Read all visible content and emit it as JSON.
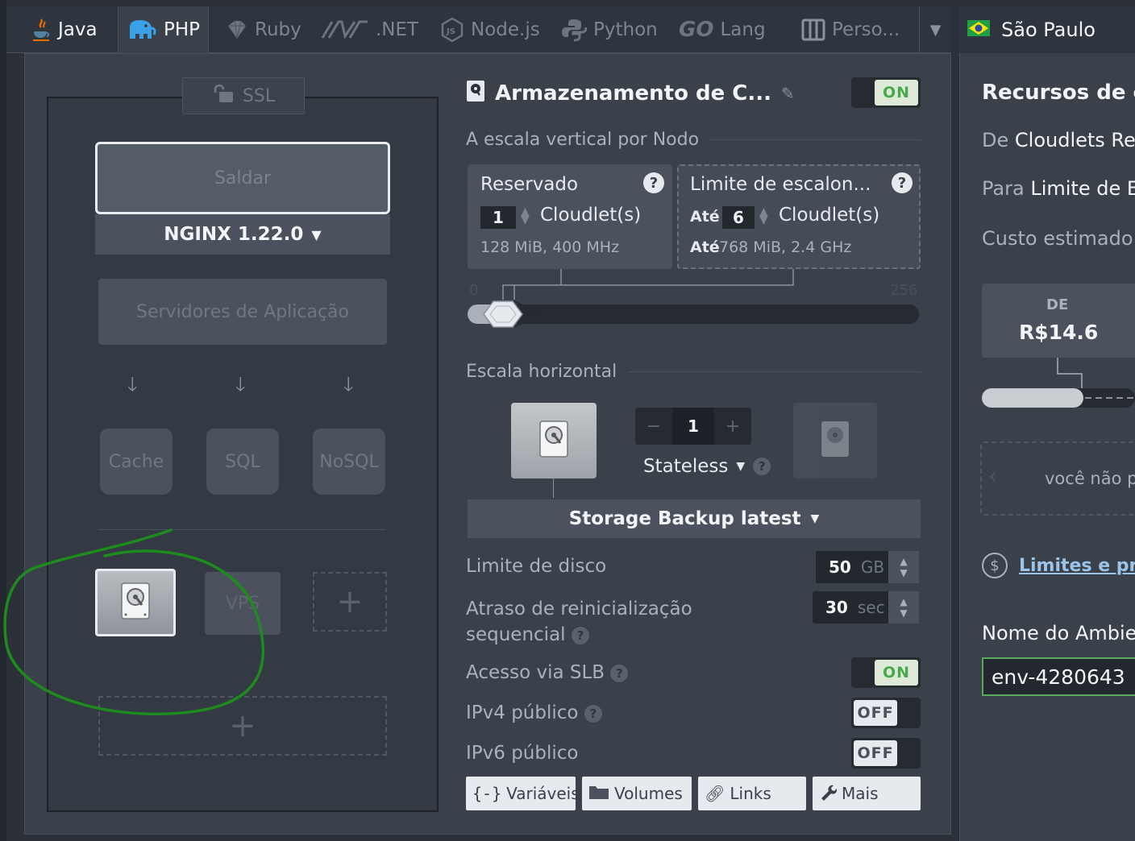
{
  "tabs": [
    {
      "label": "Java",
      "icon": "java-icon"
    },
    {
      "label": "PHP",
      "icon": "php-elephant-icon",
      "active": true
    },
    {
      "label": "Ruby",
      "icon": "ruby-icon"
    },
    {
      "label": ".NET",
      "icon": "dotnet-icon"
    },
    {
      "label": "Node.js",
      "icon": "nodejs-icon"
    },
    {
      "label": "Python",
      "icon": "python-icon"
    },
    {
      "label": "Lang",
      "icon": "go-icon",
      "prefix": "GO"
    },
    {
      "label": "Perso...",
      "icon": "custom-docker-icon"
    }
  ],
  "region": {
    "label": "São Paulo",
    "flag": "brazil-flag-icon"
  },
  "topology": {
    "ssl_label": "SSL",
    "balancer_label": "Saldar",
    "balancer_version": "NGINX 1.22.0",
    "app_servers_label": "Servidores de Aplicação",
    "cache_label": "Cache",
    "sql_label": "SQL",
    "nosql_label": "NoSQL",
    "vps_label": "VPS",
    "add_symbol": "+"
  },
  "node": {
    "title": "Armazenamento de C...",
    "enabled_label": "ON",
    "vertical_label": "A escala vertical por Nodo",
    "reserved": {
      "title": "Reservado",
      "count": "1",
      "unit": "Cloudlet(s)",
      "spec": "128 MiB, 400 MHz",
      "help": "?"
    },
    "scaling_limit": {
      "title": "Limite de escalon...",
      "prefix": "Até",
      "count": "6",
      "unit": "Cloudlet(s)",
      "spec_prefix": "Até",
      "spec": "768 MiB, 2.4 GHz",
      "help": "?"
    },
    "slider": {
      "min": "0",
      "max": "256",
      "reserved_value": 1,
      "limit_value": 6
    },
    "horizontal_label": "Escala horizontal",
    "node_count": "1",
    "minus": "−",
    "plus": "+",
    "mode": "Stateless",
    "image": "Storage Backup latest",
    "disk_limit": {
      "label": "Limite de disco",
      "value": "50",
      "unit": "GB"
    },
    "restart_delay": {
      "label": "Atraso de reinicialização sequencial",
      "value": "30",
      "unit": "sec"
    },
    "slb_access": {
      "label": "Acesso via SLB",
      "state": "ON"
    },
    "ipv4": {
      "label": "IPv4 público",
      "state": "OFF"
    },
    "ipv6": {
      "label": "IPv6 público",
      "state": "OFF"
    },
    "buttons": [
      {
        "label": "Variáveis",
        "icon": "braces-icon"
      },
      {
        "label": "Volumes",
        "icon": "folder-icon"
      },
      {
        "label": "Links",
        "icon": "link-icon"
      },
      {
        "label": "Mais",
        "icon": "wrench-icon"
      }
    ]
  },
  "resources": {
    "heading": "Recursos de c",
    "from_prefix": "De",
    "from_text": "Cloudlets Re",
    "to_prefix": "Para",
    "to_text": "Limite de E",
    "estimated": "Custo estimado",
    "price_prefix": "DE",
    "price": "R$14.6",
    "notice": "você não p",
    "limits_link": "Limites e pre",
    "env_name_label": "Nome do Ambie",
    "env_name_value": "env-4280643"
  },
  "colors": {
    "accent_on": "#4aa84c",
    "annotation": "#1f8a1f",
    "panel": "#3a414b"
  }
}
